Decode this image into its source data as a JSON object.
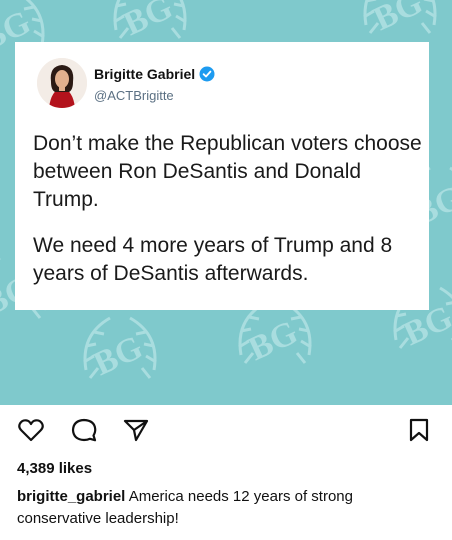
{
  "tweet": {
    "display_name": "Brigitte Gabriel",
    "handle": "@ACTBrigitte",
    "paragraph_1": "Don’t make the Republican voters choose between Ron DeSantis and Donald Trump.",
    "paragraph_2": "We need 4 more years of Trump and 8 years of DeSantis afterwards."
  },
  "post": {
    "likes": "4,389 likes",
    "caption_username": "brigitte_gabriel",
    "caption_text": "America needs 12 years of strong conservative leadership!"
  },
  "icons": {
    "like": "heart-icon",
    "comment": "comment-icon",
    "share": "send-icon",
    "save": "bookmark-icon"
  },
  "colors": {
    "background_teal": "#7fc9cc",
    "pattern": "#9fd8da",
    "verified_blue": "#1d9bf0"
  }
}
